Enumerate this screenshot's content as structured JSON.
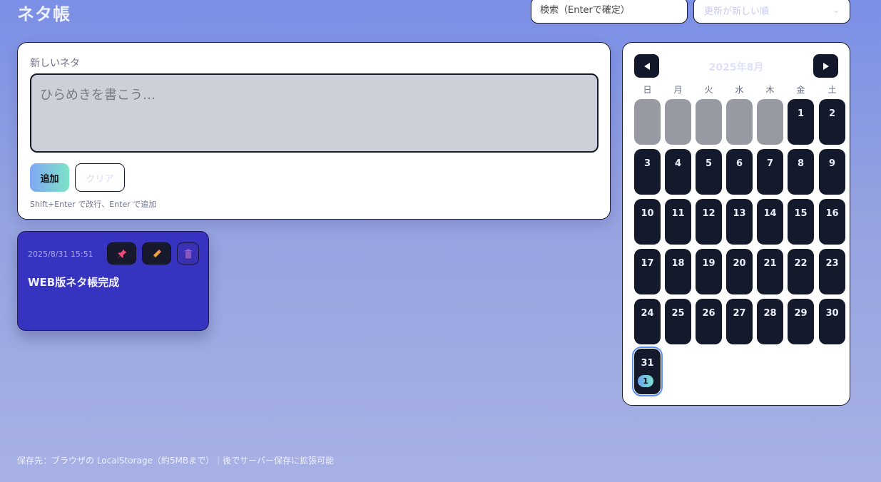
{
  "app": {
    "title": "ネタ帳"
  },
  "header": {
    "search_placeholder": "検索（Enterで確定）",
    "sort_selected": "更新が新しい順"
  },
  "editor": {
    "label": "新しいネタ",
    "placeholder": "ひらめきを書こう…",
    "add_label": "追加",
    "clear_label": "クリア",
    "hint": "Shift+Enter で改行、Enter で追加"
  },
  "notes": [
    {
      "date": "2025/8/31 15:51",
      "text": "WEB版ネタ帳完成"
    }
  ],
  "calendar": {
    "title": "2025年8月",
    "prev_icon": "◀",
    "next_icon": "▶",
    "weekdays": [
      "日",
      "月",
      "火",
      "水",
      "木",
      "金",
      "土"
    ],
    "leading_blank_count": 5,
    "days": [
      "1",
      "2",
      "3",
      "4",
      "5",
      "6",
      "7",
      "8",
      "9",
      "10",
      "11",
      "12",
      "13",
      "14",
      "15",
      "16",
      "17",
      "18",
      "19",
      "20",
      "21",
      "22",
      "23",
      "24",
      "25",
      "26",
      "27",
      "28",
      "29",
      "30",
      "31"
    ],
    "today": "31",
    "badges": {
      "31": "1"
    }
  },
  "footer": {
    "text": "保存先：ブラウザの LocalStorage（約5MBまで）｜後でサーバー保存に拡張可能"
  },
  "colors": {
    "accent": "#3733c1",
    "dark": "#141a2c",
    "highlight": "#5d8ff0"
  }
}
